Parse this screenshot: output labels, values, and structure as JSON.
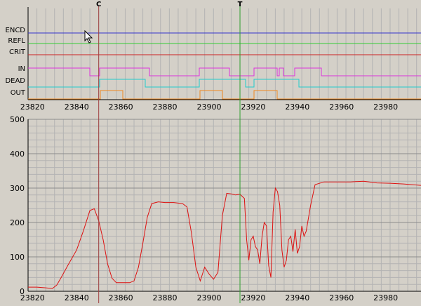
{
  "digital_panel": {
    "channels": [
      {
        "label": "ENCD",
        "color": "#3333cc"
      },
      {
        "label": "REFL",
        "color": "#33cc33"
      },
      {
        "label": "CRIT",
        "color": "#cc2222"
      },
      {
        "label": "IN",
        "color": "#dd33dd"
      },
      {
        "label": "DEAD",
        "color": "#22cccc"
      },
      {
        "label": "OUT",
        "color": "#ee8822"
      }
    ],
    "x_ticks": [
      "23820",
      "23840",
      "23860",
      "23880",
      "23900",
      "23920",
      "23940",
      "23960",
      "23980"
    ]
  },
  "cursors": {
    "c": {
      "label": "C",
      "x": 23850,
      "color": "#a04040"
    },
    "t": {
      "label": "T",
      "x": 23914,
      "color": "#30a030"
    }
  },
  "chart_data": {
    "type": "line",
    "xlim": [
      23818,
      23996
    ],
    "ylim": [
      0,
      500
    ],
    "y_ticks": [
      "0",
      "100",
      "200",
      "300",
      "400",
      "500"
    ],
    "x_ticks": [
      "23820",
      "23840",
      "23860",
      "23880",
      "23900",
      "23920",
      "23940",
      "23960",
      "23980"
    ],
    "grid": true,
    "color": "#dd1111",
    "x": [
      23818,
      23822,
      23826,
      23829,
      23831,
      23833,
      23836,
      23840,
      23843,
      23846,
      23848,
      23850,
      23852,
      23854,
      23856,
      23858,
      23861,
      23864,
      23866,
      23868,
      23870,
      23872,
      23874,
      23877,
      23880,
      23884,
      23888,
      23890,
      23892,
      23894,
      23896,
      23898,
      23900,
      23902,
      23904,
      23906,
      23908,
      23910,
      23912,
      23914,
      23916,
      23917,
      23918,
      23919,
      23920,
      23921,
      23922,
      23923,
      23924,
      23925,
      23926,
      23927,
      23928,
      23929,
      23930,
      23931,
      23932,
      23933,
      23934,
      23935,
      23936,
      23937,
      23938,
      23939,
      23940,
      23941,
      23942,
      23943,
      23944,
      23946,
      23948,
      23952,
      23958,
      23964,
      23970,
      23976,
      23982,
      23988,
      23996
    ],
    "y": [
      12,
      12,
      10,
      8,
      18,
      40,
      75,
      120,
      175,
      235,
      240,
      205,
      150,
      80,
      38,
      25,
      25,
      25,
      30,
      70,
      140,
      215,
      255,
      260,
      258,
      258,
      255,
      245,
      170,
      70,
      30,
      70,
      50,
      35,
      55,
      220,
      285,
      283,
      280,
      282,
      270,
      150,
      90,
      150,
      160,
      130,
      120,
      80,
      160,
      200,
      190,
      75,
      40,
      230,
      300,
      290,
      250,
      120,
      70,
      90,
      150,
      160,
      115,
      180,
      110,
      130,
      190,
      160,
      175,
      250,
      310,
      318,
      318,
      318,
      320,
      315,
      314,
      312,
      308
    ]
  }
}
